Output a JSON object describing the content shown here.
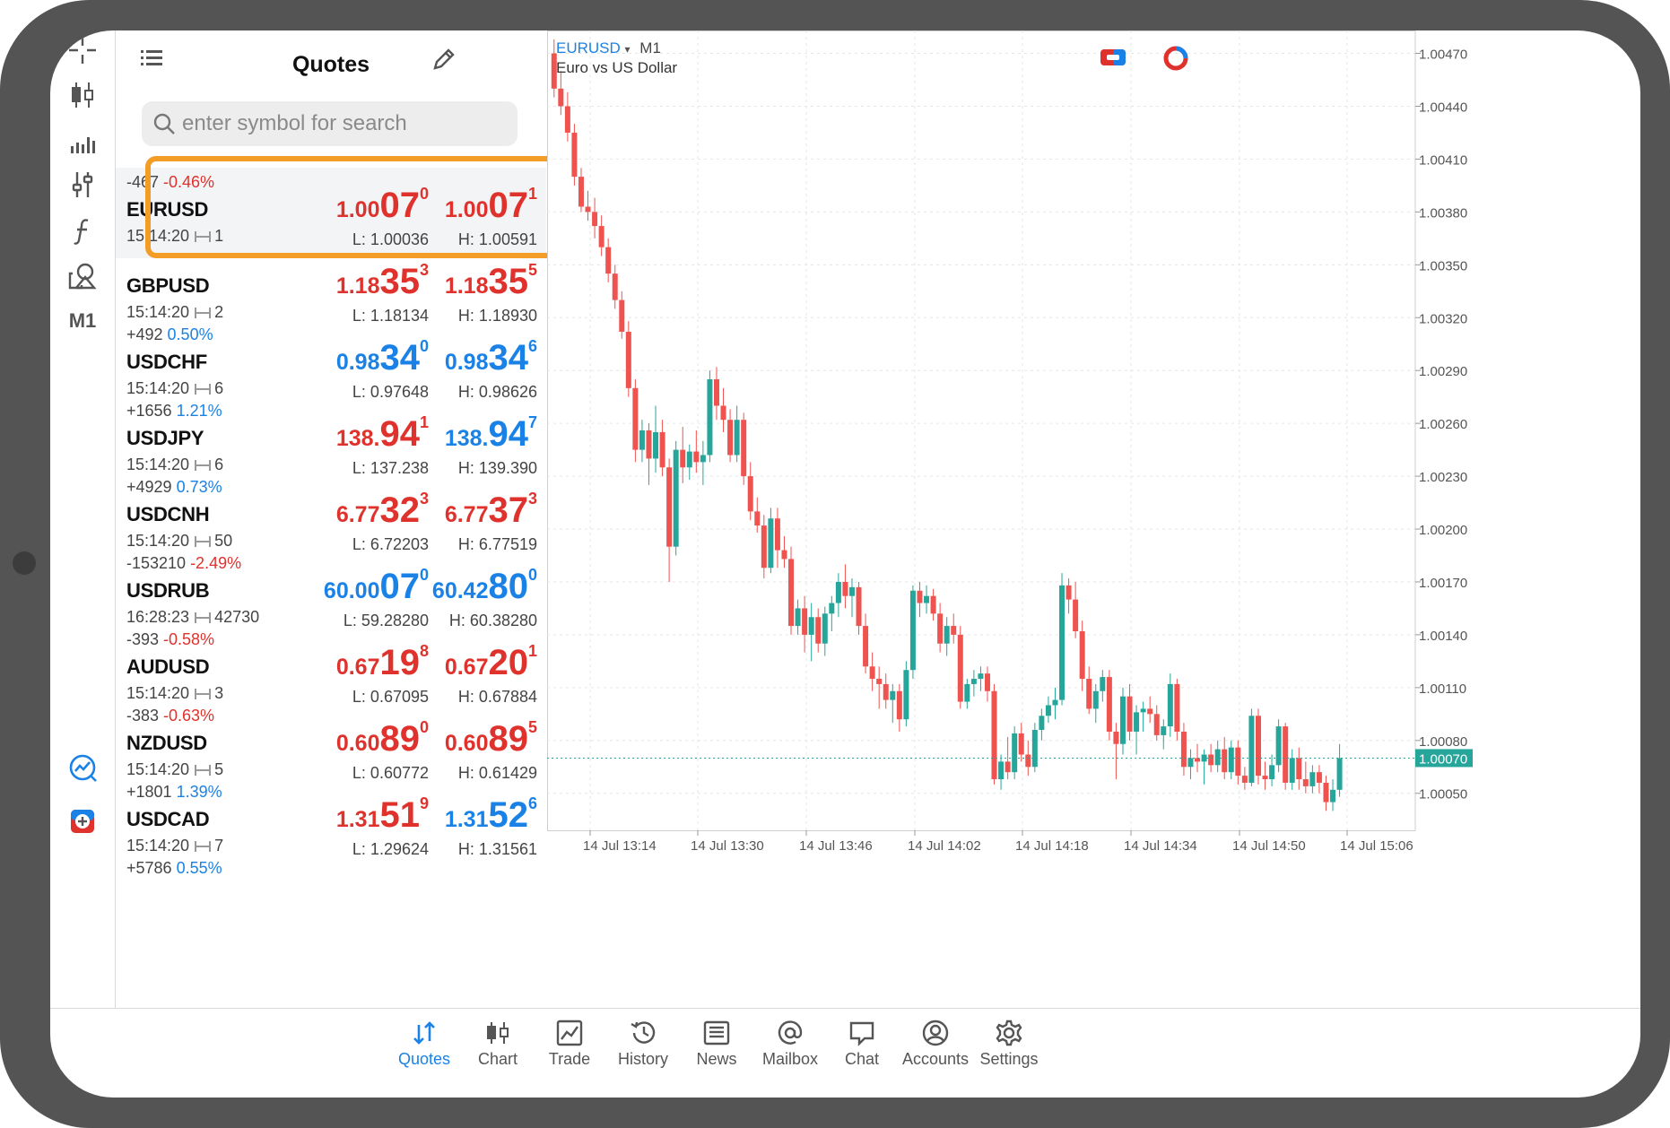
{
  "quotes_panel": {
    "title": "Quotes",
    "search_placeholder": "enter symbol for search",
    "rows": [
      {
        "change": "-467",
        "pct": "-0.46%",
        "direction": "down",
        "symbol": "EURUSD",
        "time": "15:14:20",
        "spread": "1",
        "bid_small": "1.00",
        "bid_big": "07",
        "bid_sup": "0",
        "ask_small": "1.00",
        "ask_big": "07",
        "ask_sup": "1",
        "low": "L: 1.00036",
        "high": "H: 1.00591",
        "selected": true
      },
      {
        "change": "",
        "pct": "",
        "direction": "down",
        "symbol": "GBPUSD",
        "time": "15:14:20",
        "spread": "2",
        "bid_small": "1.18",
        "bid_big": "35",
        "bid_sup": "3",
        "ask_small": "1.18",
        "ask_big": "35",
        "ask_sup": "5",
        "low": "L: 1.18134",
        "high": "H: 1.18930"
      },
      {
        "change": "+492",
        "pct": "0.50%",
        "direction": "up",
        "symbol": "USDCHF",
        "time": "15:14:20",
        "spread": "6",
        "bid_small": "0.98",
        "bid_big": "34",
        "bid_sup": "0",
        "ask_small": "0.98",
        "ask_big": "34",
        "ask_sup": "6",
        "low": "L: 0.97648",
        "high": "H: 0.98626"
      },
      {
        "change": "+1656",
        "pct": "1.21%",
        "direction": "mixed",
        "symbol": "USDJPY",
        "time": "15:14:20",
        "spread": "6",
        "bid_small": "138.",
        "bid_big": "94",
        "bid_sup": "1",
        "ask_small": "138.",
        "ask_big": "94",
        "ask_sup": "7",
        "low": "L: 137.238",
        "high": "H: 139.390"
      },
      {
        "change": "+4929",
        "pct": "0.73%",
        "direction": "down",
        "symbol": "USDCNH",
        "time": "15:14:20",
        "spread": "50",
        "bid_small": "6.77",
        "bid_big": "32",
        "bid_sup": "3",
        "ask_small": "6.77",
        "ask_big": "37",
        "ask_sup": "3",
        "low": "L: 6.72203",
        "high": "H: 6.77519"
      },
      {
        "change": "-153210",
        "pct": "-2.49%",
        "direction": "up",
        "symbol": "USDRUB",
        "time": "16:28:23",
        "spread": "42730",
        "bid_small": "60.00",
        "bid_big": "07",
        "bid_sup": "0",
        "ask_small": "60.42",
        "ask_big": "80",
        "ask_sup": "0",
        "low": "L: 59.28280",
        "high": "H: 60.38280"
      },
      {
        "change": "-393",
        "pct": "-0.58%",
        "direction": "down",
        "symbol": "AUDUSD",
        "time": "15:14:20",
        "spread": "3",
        "bid_small": "0.67",
        "bid_big": "19",
        "bid_sup": "8",
        "ask_small": "0.67",
        "ask_big": "20",
        "ask_sup": "1",
        "low": "L: 0.67095",
        "high": "H: 0.67884"
      },
      {
        "change": "-383",
        "pct": "-0.63%",
        "direction": "down",
        "symbol": "NZDUSD",
        "time": "15:14:20",
        "spread": "5",
        "bid_small": "0.60",
        "bid_big": "89",
        "bid_sup": "0",
        "ask_small": "0.60",
        "ask_big": "89",
        "ask_sup": "5",
        "low": "L: 0.60772",
        "high": "H: 0.61429"
      },
      {
        "change": "+1801",
        "pct": "1.39%",
        "direction": "mixed",
        "symbol": "USDCAD",
        "time": "15:14:20",
        "spread": "7",
        "bid_small": "1.31",
        "bid_big": "51",
        "bid_sup": "9",
        "ask_small": "1.31",
        "ask_big": "52",
        "ask_sup": "6",
        "low": "L: 1.29624",
        "high": "H: 1.31561"
      },
      {
        "change": "+5786",
        "pct": "0.55%",
        "direction": "up",
        "symbol": "",
        "time": "",
        "spread": "",
        "bid_small": "",
        "bid_big": "",
        "bid_sup": "",
        "ask_small": "",
        "ask_big": "",
        "ask_sup": "",
        "low": "",
        "high": ""
      }
    ]
  },
  "toolbar": {
    "timeframe_label": "M1"
  },
  "chart_header": {
    "symbol": "EURUSD",
    "dropdown_glyph": "▾",
    "timeframe": "M1",
    "description": "Euro vs US Dollar"
  },
  "colors": {
    "bull": "#26a69a",
    "bear": "#ef5350",
    "accent": "#1a82e6",
    "highlight": "#f39c26",
    "down_text": "#e0322d"
  },
  "chart_data": {
    "type": "candlestick",
    "title": "",
    "y_ticks": [
      "1.00470",
      "1.00440",
      "1.00410",
      "1.00380",
      "1.00350",
      "1.00320",
      "1.00290",
      "1.00260",
      "1.00230",
      "1.00200",
      "1.00170",
      "1.00140",
      "1.00110",
      "1.00080",
      "1.00050"
    ],
    "ylim": [
      1.00029,
      1.00483
    ],
    "x_ticks": [
      "14 Jul 13:14",
      "14 Jul 13:30",
      "14 Jul 13:46",
      "14 Jul 14:02",
      "14 Jul 14:18",
      "14 Jul 14:34",
      "14 Jul 14:50",
      "14 Jul 15:06"
    ],
    "current_price": "1.00070",
    "current_price_value": 1.0007,
    "grid": true,
    "ohlc": [
      [
        1.0047,
        1.00478,
        1.00445,
        1.0045
      ],
      [
        1.0045,
        1.0046,
        1.00435,
        1.0044
      ],
      [
        1.0044,
        1.00448,
        1.0042,
        1.00425
      ],
      [
        1.00425,
        1.0043,
        1.00395,
        1.004
      ],
      [
        1.004,
        1.00405,
        1.0038,
        1.00383
      ],
      [
        1.00383,
        1.00392,
        1.00375,
        1.0038
      ],
      [
        1.0038,
        1.00388,
        1.00365,
        1.00372
      ],
      [
        1.00372,
        1.00378,
        1.00355,
        1.0036
      ],
      [
        1.0036,
        1.00365,
        1.0034,
        1.00345
      ],
      [
        1.00345,
        1.0035,
        1.00325,
        1.0033
      ],
      [
        1.0033,
        1.00335,
        1.00308,
        1.00312
      ],
      [
        1.00312,
        1.00318,
        1.00275,
        1.0028
      ],
      [
        1.0028,
        1.00285,
        1.00238,
        1.00245
      ],
      [
        1.00245,
        1.00262,
        1.00238,
        1.00256
      ],
      [
        1.00256,
        1.0026,
        1.00225,
        1.0024
      ],
      [
        1.0024,
        1.0027,
        1.00232,
        1.00255
      ],
      [
        1.00255,
        1.00262,
        1.0023,
        1.00235
      ],
      [
        1.00235,
        1.0024,
        1.0017,
        1.0019
      ],
      [
        1.0019,
        1.0025,
        1.00185,
        1.00245
      ],
      [
        1.00245,
        1.00258,
        1.00226,
        1.00235
      ],
      [
        1.00235,
        1.00248,
        1.00228,
        1.00244
      ],
      [
        1.00244,
        1.00256,
        1.00232,
        1.00238
      ],
      [
        1.00238,
        1.0025,
        1.00225,
        1.00242
      ],
      [
        1.00242,
        1.0029,
        1.00238,
        1.00285
      ],
      [
        1.00285,
        1.00292,
        1.00262,
        1.0027
      ],
      [
        1.0027,
        1.0028,
        1.00255,
        1.00262
      ],
      [
        1.00262,
        1.00268,
        1.00238,
        1.00242
      ],
      [
        1.00242,
        1.0027,
        1.00238,
        1.00262
      ],
      [
        1.00262,
        1.00266,
        1.00225,
        1.0023
      ],
      [
        1.0023,
        1.00238,
        1.00205,
        1.0021
      ],
      [
        1.0021,
        1.00218,
        1.00198,
        1.00202
      ],
      [
        1.00202,
        1.00208,
        1.00172,
        1.00178
      ],
      [
        1.00178,
        1.00212,
        1.00175,
        1.00206
      ],
      [
        1.00206,
        1.00212,
        1.00178,
        1.00188
      ],
      [
        1.00188,
        1.00196,
        1.00178,
        1.00183
      ],
      [
        1.00183,
        1.0019,
        1.0014,
        1.00145
      ],
      [
        1.00145,
        1.0016,
        1.0014,
        1.00155
      ],
      [
        1.00155,
        1.00162,
        1.0013,
        1.0014
      ],
      [
        1.0014,
        1.00158,
        1.00125,
        1.0015
      ],
      [
        1.0015,
        1.00155,
        1.0013,
        1.00135
      ],
      [
        1.00135,
        1.00156,
        1.00128,
        1.00152
      ],
      [
        1.00152,
        1.00162,
        1.00142,
        1.00158
      ],
      [
        1.00158,
        1.00175,
        1.0015,
        1.0017
      ],
      [
        1.0017,
        1.0018,
        1.00155,
        1.00162
      ],
      [
        1.00162,
        1.00172,
        1.0015,
        1.00167
      ],
      [
        1.00167,
        1.0017,
        1.0014,
        1.00145
      ],
      [
        1.00145,
        1.00152,
        1.00118,
        1.00122
      ],
      [
        1.00122,
        1.0013,
        1.00108,
        1.00115
      ],
      [
        1.00115,
        1.00122,
        1.00098,
        1.00112
      ],
      [
        1.00112,
        1.00118,
        1.00098,
        1.00103
      ],
      [
        1.00103,
        1.00112,
        1.0009,
        1.00108
      ],
      [
        1.00108,
        1.00112,
        1.00085,
        1.00092
      ],
      [
        1.00092,
        1.00125,
        1.00088,
        1.0012
      ],
      [
        1.0012,
        1.00168,
        1.00115,
        1.00165
      ],
      [
        1.00165,
        1.0017,
        1.0015,
        1.00158
      ],
      [
        1.00158,
        1.00168,
        1.00152,
        1.00162
      ],
      [
        1.00162,
        1.00166,
        1.00148,
        1.00152
      ],
      [
        1.00152,
        1.00158,
        1.0013,
        1.00135
      ],
      [
        1.00135,
        1.0015,
        1.00128,
        1.00145
      ],
      [
        1.00145,
        1.00152,
        1.00135,
        1.0014
      ],
      [
        1.0014,
        1.00145,
        1.00098,
        1.00102
      ],
      [
        1.00102,
        1.00115,
        1.00098,
        1.00112
      ],
      [
        1.00112,
        1.0012,
        1.00105,
        1.00115
      ],
      [
        1.00115,
        1.00122,
        1.00108,
        1.00118
      ],
      [
        1.00118,
        1.00122,
        1.00102,
        1.00108
      ],
      [
        1.00108,
        1.00112,
        1.00055,
        1.00058
      ],
      [
        1.00058,
        1.00072,
        1.00052,
        1.00068
      ],
      [
        1.00068,
        1.00082,
        1.00058,
        1.00062
      ],
      [
        1.00062,
        1.00088,
        1.00058,
        1.00084
      ],
      [
        1.00084,
        1.0009,
        1.00068,
        1.00072
      ],
      [
        1.00072,
        1.0008,
        1.0006,
        1.00065
      ],
      [
        1.00065,
        1.0009,
        1.00062,
        1.00086
      ],
      [
        1.00086,
        1.00098,
        1.0008,
        1.00094
      ],
      [
        1.00094,
        1.00105,
        1.0009,
        1.001
      ],
      [
        1.001,
        1.0011,
        1.00092,
        1.00103
      ],
      [
        1.00103,
        1.00175,
        1.001,
        1.00168
      ],
      [
        1.00168,
        1.00172,
        1.00152,
        1.0016
      ],
      [
        1.0016,
        1.0017,
        1.00138,
        1.00142
      ],
      [
        1.00142,
        1.00148,
        1.00108,
        1.00115
      ],
      [
        1.00115,
        1.00122,
        1.00095,
        1.00098
      ],
      [
        1.00098,
        1.00112,
        1.0009,
        1.00108
      ],
      [
        1.00108,
        1.0012,
        1.00102,
        1.00116
      ],
      [
        1.00116,
        1.0012,
        1.0008,
        1.00085
      ],
      [
        1.00085,
        1.0009,
        1.00058,
        1.00078
      ],
      [
        1.00078,
        1.0011,
        1.00072,
        1.00105
      ],
      [
        1.00105,
        1.00112,
        1.0008,
        1.00085
      ],
      [
        1.00085,
        1.001,
        1.00072,
        1.00096
      ],
      [
        1.00096,
        1.00102,
        1.00085,
        1.00098
      ],
      [
        1.00098,
        1.00105,
        1.0009,
        1.00095
      ],
      [
        1.00095,
        1.001,
        1.0008,
        1.00083
      ],
      [
        1.00083,
        1.00092,
        1.00075,
        1.00088
      ],
      [
        1.00088,
        1.00118,
        1.00082,
        1.00112
      ],
      [
        1.00112,
        1.00115,
        1.0008,
        1.00085
      ],
      [
        1.00085,
        1.0009,
        1.0006,
        1.00065
      ],
      [
        1.00065,
        1.00075,
        1.00058,
        1.0007
      ],
      [
        1.0007,
        1.00078,
        1.00062,
        1.00068
      ],
      [
        1.00068,
        1.00075,
        1.00055,
        1.00072
      ],
      [
        1.00072,
        1.00078,
        1.00062,
        1.00066
      ],
      [
        1.00066,
        1.0008,
        1.00062,
        1.00075
      ],
      [
        1.00075,
        1.00082,
        1.00058,
        1.00062
      ],
      [
        1.00062,
        1.0008,
        1.00058,
        1.00076
      ],
      [
        1.00076,
        1.0008,
        1.00055,
        1.0006
      ],
      [
        1.0006,
        1.00065,
        1.00052,
        1.00056
      ],
      [
        1.00056,
        1.00098,
        1.00054,
        1.00094
      ],
      [
        1.00094,
        1.00098,
        1.00055,
        1.0006
      ],
      [
        1.0006,
        1.00068,
        1.00052,
        1.00058
      ],
      [
        1.00058,
        1.00072,
        1.00054,
        1.00066
      ],
      [
        1.00066,
        1.00092,
        1.00062,
        1.00088
      ],
      [
        1.00088,
        1.0009,
        1.00052,
        1.00056
      ],
      [
        1.00056,
        1.00075,
        1.00052,
        1.0007
      ],
      [
        1.0007,
        1.00076,
        1.00052,
        1.00058
      ],
      [
        1.00058,
        1.00068,
        1.0005,
        1.00054
      ],
      [
        1.00054,
        1.00066,
        1.0005,
        1.00062
      ],
      [
        1.00062,
        1.00066,
        1.0005,
        1.00056
      ],
      [
        1.00056,
        1.0006,
        1.0004,
        1.00045
      ],
      [
        1.00045,
        1.00058,
        1.0004,
        1.00052
      ],
      [
        1.00052,
        1.00078,
        1.00048,
        1.0007
      ]
    ]
  },
  "bottom_nav": [
    {
      "label": "Quotes",
      "icon": "quotes-arrows-icon",
      "active": true
    },
    {
      "label": "Chart",
      "icon": "candles-icon"
    },
    {
      "label": "Trade",
      "icon": "trade-chart-icon"
    },
    {
      "label": "History",
      "icon": "history-clock-icon"
    },
    {
      "label": "News",
      "icon": "news-icon"
    },
    {
      "label": "Mailbox",
      "icon": "at-sign-icon"
    },
    {
      "label": "Chat",
      "icon": "chat-bubble-icon"
    },
    {
      "label": "Accounts",
      "icon": "account-circle-icon"
    },
    {
      "label": "Settings",
      "icon": "gear-icon"
    }
  ]
}
